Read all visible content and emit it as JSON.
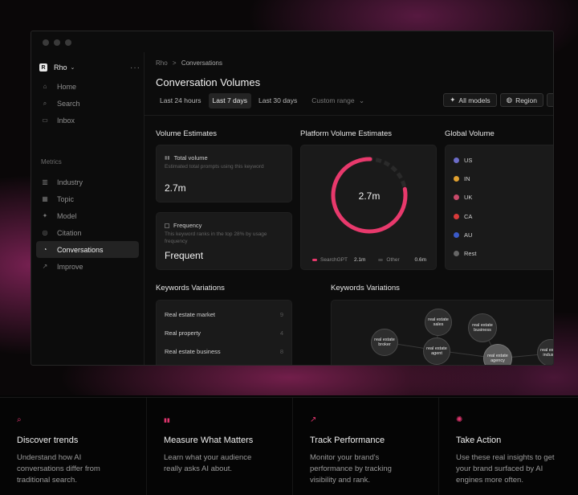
{
  "workspace": {
    "logo": "R",
    "name": "Rho"
  },
  "sidebar": {
    "nav": [
      {
        "label": "Home",
        "icon": "home-icon",
        "glyph": "⌂"
      },
      {
        "label": "Search",
        "icon": "search-icon",
        "glyph": "⌕"
      },
      {
        "label": "Inbox",
        "icon": "inbox-icon",
        "glyph": "▭"
      }
    ],
    "section": "Metrics",
    "metrics": [
      {
        "label": "Industry",
        "icon": "industry-icon",
        "glyph": "▥"
      },
      {
        "label": "Topic",
        "icon": "topic-icon",
        "glyph": "▦"
      },
      {
        "label": "Model",
        "icon": "sparkle-icon",
        "glyph": "✦"
      },
      {
        "label": "Citation",
        "icon": "citation-icon",
        "glyph": "◎"
      },
      {
        "label": "Conversations",
        "icon": "chat-icon",
        "glyph": "◔"
      },
      {
        "label": "Improve",
        "icon": "trend-icon",
        "glyph": "↗"
      }
    ]
  },
  "header": {
    "breadcrumb_root": "Rho",
    "breadcrumb_sep": ">",
    "breadcrumb_current": "Conversations",
    "title": "Conversation Volumes",
    "ranges": [
      "Last 24 hours",
      "Last 7 days",
      "Last 30 days"
    ],
    "active_range": "Last 7 days",
    "custom_range": "Custom range",
    "all_models": "All models",
    "region": "Region"
  },
  "volume": {
    "heading": "Volume Estimates",
    "total_label": "Total volume",
    "total_desc": "Estimated total prompts using this keyword",
    "total_value": "2.7m",
    "freq_label": "Frequency",
    "freq_desc": "This keyword ranks in the top 28% by usage frequency",
    "freq_value": "Frequent"
  },
  "platform": {
    "heading": "Platform Volume Estimates",
    "center_value": "2.7m",
    "legend": [
      {
        "name": "SearchGPT",
        "value": "2.1m",
        "color": "#e8396c"
      },
      {
        "name": "Other",
        "value": "0.6m",
        "color": "#444444"
      }
    ],
    "share_primary": 0.78
  },
  "global": {
    "heading": "Global Volume",
    "regions": [
      {
        "code": "US",
        "color": "#6c6cc8"
      },
      {
        "code": "IN",
        "color": "#e0a030"
      },
      {
        "code": "UK",
        "color": "#c84a6a"
      },
      {
        "code": "CA",
        "color": "#d83a3a"
      },
      {
        "code": "AU",
        "color": "#3a5ac8"
      },
      {
        "code": "Rest",
        "color": "#666666"
      }
    ]
  },
  "keywords": {
    "heading": "Keywords Variations",
    "rows": [
      {
        "text": "Real estate market",
        "n": "9"
      },
      {
        "text": "Real property",
        "n": "4"
      },
      {
        "text": "Real estate business",
        "n": "8"
      }
    ],
    "graph_heading": "Keywords Variations",
    "bubbles": [
      "real estate sales",
      "real estate business",
      "real estate broker",
      "real estate agent",
      "real estate agency",
      "real estate industry"
    ]
  },
  "features": [
    {
      "icon": "search-icon",
      "glyph": "⌕",
      "title": "Discover trends",
      "desc": "Understand how AI conversations differ from traditional search."
    },
    {
      "icon": "bar-chart-icon",
      "glyph": "▮▮",
      "title": "Measure What Matters",
      "desc": "Learn what your audience really asks AI about."
    },
    {
      "icon": "trend-up-icon",
      "glyph": "↗",
      "title": "Track Performance",
      "desc": "Monitor your brand's performance by tracking visibility and rank."
    },
    {
      "icon": "sparkle-icon",
      "glyph": "✺",
      "title": "Take Action",
      "desc": "Use these real insights to get your brand surfaced by AI engines more often."
    }
  ]
}
